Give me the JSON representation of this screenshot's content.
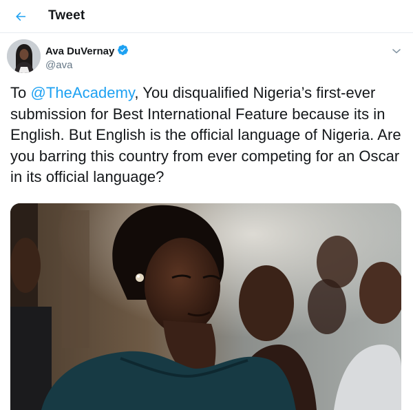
{
  "header": {
    "title": "Tweet",
    "back_icon": "arrow-left-icon",
    "accent_color": "#1da1f2"
  },
  "tweet": {
    "author": {
      "display_name": "Ava DuVernay",
      "handle": "@ava",
      "verified": true,
      "verified_icon": "verified-badge-icon"
    },
    "menu_icon": "chevron-down-icon",
    "text_prefix": "To ",
    "mention": "@TheAcademy",
    "text_body": ", You disqualified Nigeria’s first-ever submission for Best International Feature because its in English. But English is the official language of Nigeria. Are you barring this country from ever competing for an Oscar in its official language?"
  }
}
